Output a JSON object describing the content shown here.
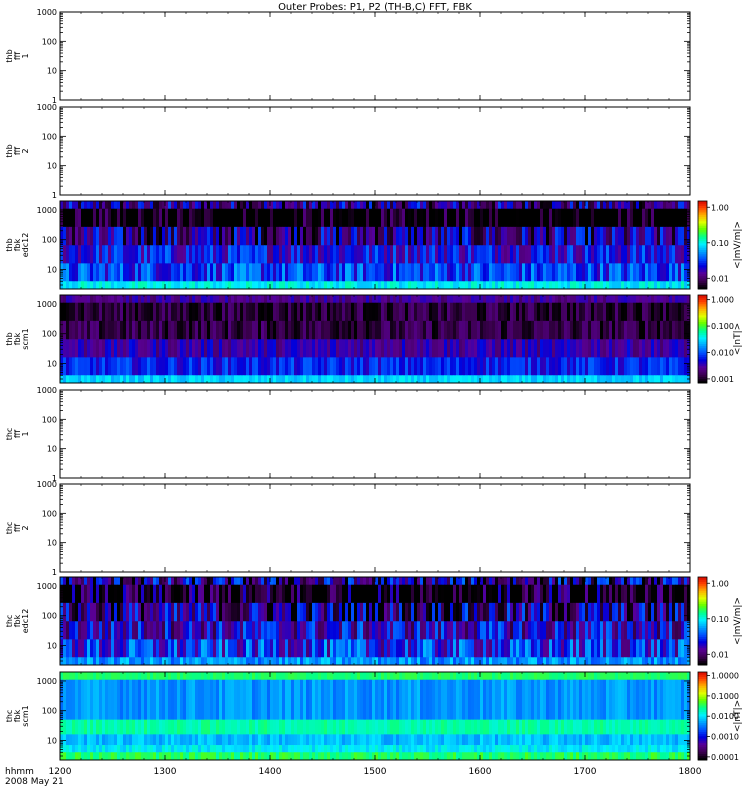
{
  "title": "Outer Probes: P1, P2 (TH-B,C) FFT, FBK",
  "time_axis": {
    "unit_label": "hhmm",
    "date_label": "2008 May 21",
    "ticks": [
      "1200",
      "1300",
      "1400",
      "1500",
      "1600",
      "1700",
      "1800"
    ],
    "range": [
      1200,
      1800
    ]
  },
  "chart_data": [
    {
      "type": "heatmap",
      "panel": "thb-fff-1",
      "ylabel_lines": [
        "thb",
        "fff",
        "1"
      ],
      "yscale": "log",
      "ylim": [
        1,
        1000
      ],
      "yticks": [
        "1000",
        "100",
        "10",
        "1"
      ],
      "colorbar": null,
      "has_data": false
    },
    {
      "type": "heatmap",
      "panel": "thb-fff-2",
      "ylabel_lines": [
        "thb",
        "fff",
        "2"
      ],
      "yscale": "log",
      "ylim": [
        1,
        1000
      ],
      "yticks": [
        "1000",
        "100",
        "10",
        "1"
      ],
      "colorbar": null,
      "has_data": false
    },
    {
      "type": "heatmap",
      "panel": "thb-fbk-edc12",
      "ylabel_lines": [
        "thb",
        "fbk",
        "edc12"
      ],
      "yscale": "log",
      "ylim": [
        2.2,
        2000
      ],
      "yticks": [
        "1000",
        "100",
        "10"
      ],
      "colorbar": {
        "label": "<|mV/m|>",
        "scale": "log",
        "range": [
          0.005,
          1.5
        ],
        "ticks": [
          "1.00",
          "0.10",
          "0.01"
        ],
        "tick_values": [
          1.0,
          0.1,
          0.01
        ]
      },
      "has_data": true,
      "bands": [
        {
          "f_range": [
            1100,
            2000
          ],
          "level": 0.012,
          "var": 0.9
        },
        {
          "f_range": [
            270,
            1100
          ],
          "level": 0.0035,
          "var": 1.0
        },
        {
          "f_range": [
            65,
            270
          ],
          "level": 0.012,
          "var": 0.9
        },
        {
          "f_range": [
            16,
            65
          ],
          "level": 0.022,
          "var": 0.6
        },
        {
          "f_range": [
            4,
            16
          ],
          "level": 0.03,
          "var": 0.6
        },
        {
          "f_range": [
            2.2,
            4
          ],
          "level": 0.09,
          "var": 0.3
        }
      ]
    },
    {
      "type": "heatmap",
      "panel": "thb-fbk-scm1",
      "ylabel_lines": [
        "thb",
        "fbk",
        "scm1"
      ],
      "yscale": "log",
      "ylim": [
        2.2,
        2000
      ],
      "yticks": [
        "1000",
        "100",
        "10"
      ],
      "colorbar": {
        "label": "<|nT|>",
        "scale": "log",
        "range": [
          0.0007,
          1.5
        ],
        "ticks": [
          "1.000",
          "0.100",
          "0.010",
          "0.001"
        ],
        "tick_values": [
          1.0,
          0.1,
          0.01,
          0.001
        ]
      },
      "has_data": true,
      "bands": [
        {
          "f_range": [
            1100,
            2000
          ],
          "level": 0.0025,
          "var": 0.4
        },
        {
          "f_range": [
            270,
            1100
          ],
          "level": 0.0011,
          "var": 0.5
        },
        {
          "f_range": [
            65,
            270
          ],
          "level": 0.0012,
          "var": 0.5
        },
        {
          "f_range": [
            16,
            65
          ],
          "level": 0.003,
          "var": 0.5
        },
        {
          "f_range": [
            4,
            16
          ],
          "level": 0.006,
          "var": 0.5
        },
        {
          "f_range": [
            2.2,
            4
          ],
          "level": 0.025,
          "var": 0.3
        }
      ]
    },
    {
      "type": "heatmap",
      "panel": "thc-fff-1",
      "ylabel_lines": [
        "thc",
        "fff",
        "1"
      ],
      "yscale": "log",
      "ylim": [
        1,
        1000
      ],
      "yticks": [
        "1000",
        "100",
        "10",
        "1"
      ],
      "colorbar": null,
      "has_data": false
    },
    {
      "type": "heatmap",
      "panel": "thc-fff-2",
      "ylabel_lines": [
        "thc",
        "fff",
        "2"
      ],
      "yscale": "log",
      "ylim": [
        1,
        1000
      ],
      "yticks": [
        "1000",
        "100",
        "10",
        "1"
      ],
      "colorbar": null,
      "has_data": false
    },
    {
      "type": "heatmap",
      "panel": "thc-fbk-edc12",
      "ylabel_lines": [
        "thc",
        "fbk",
        "edc12"
      ],
      "yscale": "log",
      "ylim": [
        2.2,
        2000
      ],
      "yticks": [
        "1000",
        "100",
        "10"
      ],
      "colorbar": {
        "label": "<|mV/m|>",
        "scale": "log",
        "range": [
          0.005,
          1.5
        ],
        "ticks": [
          "1.00",
          "0.10",
          "0.01"
        ],
        "tick_values": [
          1.0,
          0.1,
          0.01
        ]
      },
      "has_data": true,
      "bands": [
        {
          "f_range": [
            1100,
            2000
          ],
          "level": 0.012,
          "var": 1.1
        },
        {
          "f_range": [
            270,
            1100
          ],
          "level": 0.005,
          "var": 1.2
        },
        {
          "f_range": [
            65,
            270
          ],
          "level": 0.012,
          "var": 1.0
        },
        {
          "f_range": [
            16,
            65
          ],
          "level": 0.018,
          "var": 0.8
        },
        {
          "f_range": [
            4,
            16
          ],
          "level": 0.025,
          "var": 0.8
        },
        {
          "f_range": [
            2.2,
            4
          ],
          "level": 0.05,
          "var": 0.4
        }
      ]
    },
    {
      "type": "heatmap",
      "panel": "thc-fbk-scm1",
      "ylabel_lines": [
        "thc",
        "fbk",
        "scm1"
      ],
      "yscale": "log",
      "ylim": [
        2.2,
        2000
      ],
      "yticks": [
        "1000",
        "100",
        "10"
      ],
      "colorbar": {
        "label": "<|nT|>",
        "scale": "log",
        "range": [
          7e-05,
          1.5
        ],
        "ticks": [
          "1.0000",
          "0.1000",
          "0.0100",
          "0.0010",
          "0.0001"
        ],
        "tick_values": [
          1.0,
          0.1,
          0.01,
          0.001,
          0.0001
        ]
      },
      "has_data": true,
      "bands": [
        {
          "f_range": [
            1100,
            2000
          ],
          "level": 0.03,
          "var": 0.2
        },
        {
          "f_range": [
            50,
            1100
          ],
          "level": 0.004,
          "var": 0.4
        },
        {
          "f_range": [
            16,
            50
          ],
          "level": 0.02,
          "var": 0.3
        },
        {
          "f_range": [
            7,
            16
          ],
          "level": 0.006,
          "var": 0.4
        },
        {
          "f_range": [
            4,
            7
          ],
          "level": 0.01,
          "var": 0.4
        },
        {
          "f_range": [
            2.2,
            4
          ],
          "level": 0.03,
          "var": 0.4
        }
      ]
    }
  ],
  "colormap": [
    "#000000",
    "#3c0050",
    "#5a0096",
    "#0000dc",
    "#0050ff",
    "#00a0ff",
    "#00f0ff",
    "#00ff90",
    "#60ff00",
    "#e0ff00",
    "#ffb000",
    "#ff4000",
    "#d00000"
  ]
}
